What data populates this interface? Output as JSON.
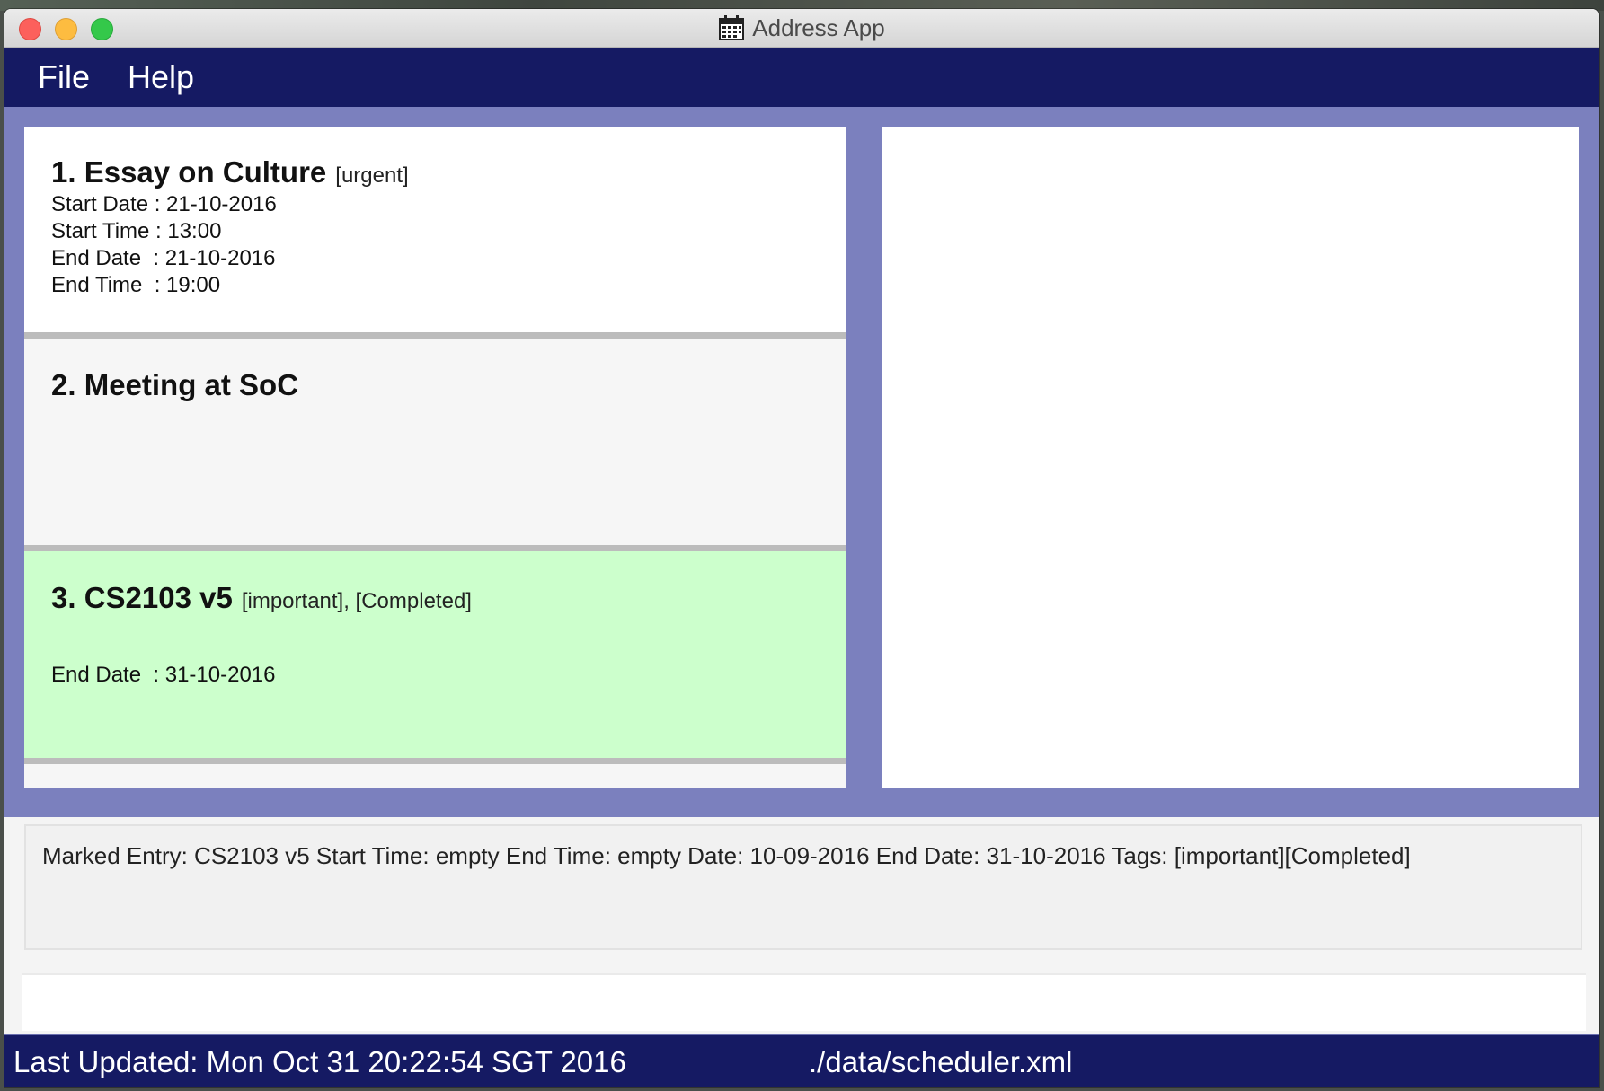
{
  "window": {
    "title": "Address App"
  },
  "menu": {
    "items": [
      "File",
      "Help"
    ]
  },
  "tasks": [
    {
      "index": "1.",
      "name": "Essay on Culture",
      "tags": "[urgent]",
      "start_date": "Start Date : 21-10-2016",
      "start_time": "Start Time : 13:00",
      "end_date": "End Date  : 21-10-2016",
      "end_time": "End Time  : 19:00",
      "background": "#ffffff"
    },
    {
      "index": "2.",
      "name": "Meeting at SoC",
      "tags": "",
      "background": "#f6f6f6"
    },
    {
      "index": "3.",
      "name": "CS2103 v5",
      "tags": "[important], [Completed]",
      "end_date": "End Date  : 31-10-2016",
      "background": "#ccffcc"
    }
  ],
  "result": {
    "text": "Marked Entry: CS2103 v5 Start Time: empty End Time: empty Date: 10-09-2016 End Date: 31-10-2016 Tags: [important][Completed]"
  },
  "command": {
    "value": ""
  },
  "status": {
    "last_updated": "Last Updated: Mon Oct 31 20:22:54 SGT 2016",
    "file_path": "./data/scheduler.xml"
  },
  "colors": {
    "menubar": "#151a63",
    "panel_background": "#7b80be",
    "completed_card": "#ccffcc"
  }
}
